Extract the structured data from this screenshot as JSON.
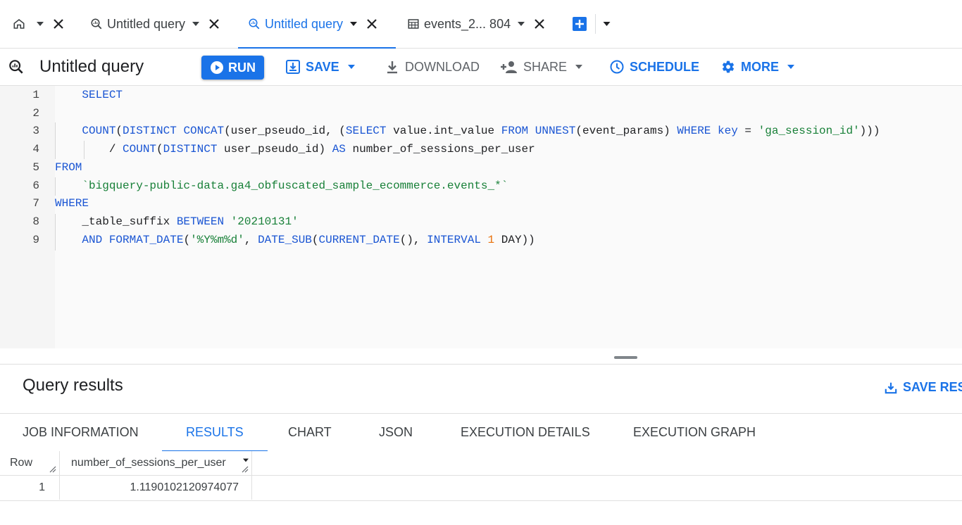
{
  "tabs": [
    {
      "label": "",
      "icon": "home-icon",
      "active": false
    },
    {
      "label": "Untitled query",
      "icon": "query-icon",
      "active": false
    },
    {
      "label": "Untitled query",
      "icon": "query-icon",
      "active": true
    },
    {
      "label": "events_2... 804",
      "icon": "table-icon",
      "active": false
    }
  ],
  "toolbar": {
    "title": "Untitled query",
    "run_label": "RUN",
    "save_label": "SAVE",
    "download_label": "DOWNLOAD",
    "share_label": "SHARE",
    "schedule_label": "SCHEDULE",
    "more_label": "MORE"
  },
  "editor": {
    "line_numbers": [
      "1",
      "2",
      "3",
      "4",
      "5",
      "6",
      "7",
      "8",
      "9"
    ],
    "lines": [
      [
        {
          "t": "    "
        },
        {
          "t": "SELECT",
          "c": "kw"
        }
      ],
      [
        {
          "t": ""
        }
      ],
      [
        {
          "t": "    "
        },
        {
          "t": "COUNT",
          "c": "fn"
        },
        {
          "t": "("
        },
        {
          "t": "DISTINCT",
          "c": "kw"
        },
        {
          "t": " "
        },
        {
          "t": "CONCAT",
          "c": "fn"
        },
        {
          "t": "(user_pseudo_id, ("
        },
        {
          "t": "SELECT",
          "c": "kw"
        },
        {
          "t": " value.int_value "
        },
        {
          "t": "FROM",
          "c": "kw"
        },
        {
          "t": " "
        },
        {
          "t": "UNNEST",
          "c": "fn"
        },
        {
          "t": "(event_params) "
        },
        {
          "t": "WHERE",
          "c": "kw"
        },
        {
          "t": " "
        },
        {
          "t": "key",
          "c": "kw"
        },
        {
          "t": " = "
        },
        {
          "t": "'ga_session_id'",
          "c": "str"
        },
        {
          "t": ")))"
        }
      ],
      [
        {
          "t": "        / "
        },
        {
          "t": "COUNT",
          "c": "fn"
        },
        {
          "t": "("
        },
        {
          "t": "DISTINCT",
          "c": "kw"
        },
        {
          "t": " user_pseudo_id) "
        },
        {
          "t": "AS",
          "c": "kw"
        },
        {
          "t": " number_of_sessions_per_user"
        }
      ],
      [
        {
          "t": "FROM",
          "c": "kw"
        }
      ],
      [
        {
          "t": "    "
        },
        {
          "t": "`bigquery-public-data.ga4_obfuscated_sample_ecommerce.events_*`",
          "c": "str"
        }
      ],
      [
        {
          "t": "WHERE",
          "c": "kw"
        }
      ],
      [
        {
          "t": "    _table_suffix "
        },
        {
          "t": "BETWEEN",
          "c": "kw"
        },
        {
          "t": " "
        },
        {
          "t": "'20210131'",
          "c": "str"
        }
      ],
      [
        {
          "t": "    "
        },
        {
          "t": "AND",
          "c": "kw"
        },
        {
          "t": " "
        },
        {
          "t": "FORMAT_DATE",
          "c": "fn"
        },
        {
          "t": "("
        },
        {
          "t": "'%Y%m%d'",
          "c": "str"
        },
        {
          "t": ", "
        },
        {
          "t": "DATE_SUB",
          "c": "fn"
        },
        {
          "t": "("
        },
        {
          "t": "CURRENT_DATE",
          "c": "fn"
        },
        {
          "t": "(), "
        },
        {
          "t": "INTERVAL",
          "c": "kw"
        },
        {
          "t": " "
        },
        {
          "t": "1",
          "c": "num"
        },
        {
          "t": " DAY))"
        }
      ]
    ]
  },
  "results": {
    "title": "Query results",
    "save_label": "SAVE RES",
    "tabs": [
      "JOB INFORMATION",
      "RESULTS",
      "CHART",
      "JSON",
      "EXECUTION DETAILS",
      "EXECUTION GRAPH"
    ],
    "active_tab": "RESULTS",
    "columns": [
      "Row",
      "number_of_sessions_per_user"
    ],
    "rows": [
      [
        "1",
        "1.1190102120974077"
      ]
    ]
  },
  "colors": {
    "accent": "#1a73e8",
    "keyword": "#1a55d3",
    "string": "#188038",
    "number": "#e8710a"
  }
}
